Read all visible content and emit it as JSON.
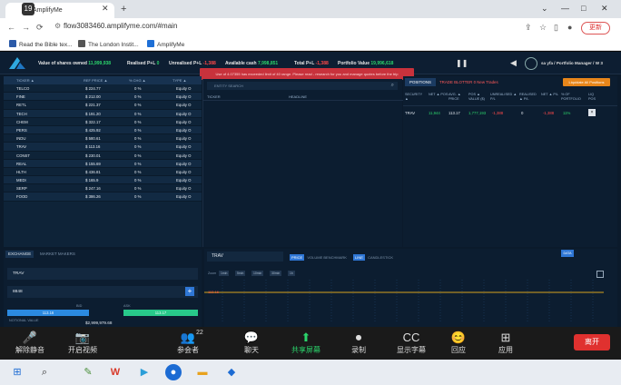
{
  "browser": {
    "tab_title": "AmplifyMe",
    "url": "flow3083460.amplifyme.com/#main",
    "update_label": "更新",
    "bookmarks": [
      "Read the Bible tex...",
      "The London Instit...",
      "AmplifyMe"
    ],
    "zoom_badge": "19"
  },
  "topbar": {
    "shares_label": "Value of shares owned",
    "shares_value": "11,999,938",
    "realised_label": "Realised P+L",
    "realised_value": "0",
    "unrealised_label": "Unrealised P+L",
    "unrealised_value": "-1,388",
    "cash_label": "Available cash",
    "cash_value": "7,998,851",
    "total_label": "Total P+L",
    "total_value": "-1,388",
    "portfolio_label": "Portfolio Value",
    "portfolio_value": "19,996,618",
    "alert": "Use of 4.07355 has exceeded limit of 40 range. Please read - research for you and manage quotes before the trip",
    "user_info": "sa yfa / Portfolio Manager / W 3"
  },
  "ticker": {
    "headers": [
      "TICKER ▲",
      "REF PRICE ▲",
      "% CHG ▲",
      "TYPE ▲"
    ],
    "rows": [
      {
        "ticker": "TELCO",
        "price": "$ 224.77",
        "chg": "0 %",
        "type": "Equity O"
      },
      {
        "ticker": "FINE",
        "price": "$ 212.00",
        "chg": "0 %",
        "type": "Equity O"
      },
      {
        "ticker": "RETL",
        "price": "$ 221.37",
        "chg": "0 %",
        "type": "Equity O"
      },
      {
        "ticker": "TECH",
        "price": "$ 191.20",
        "chg": "0 %",
        "type": "Equity O"
      },
      {
        "ticker": "CHEM",
        "price": "$ 322.17",
        "chg": "0 %",
        "type": "Equity O"
      },
      {
        "ticker": "PERS",
        "price": "$ 425.92",
        "chg": "0 %",
        "type": "Equity O"
      },
      {
        "ticker": "INDU",
        "price": "$ 580.61",
        "chg": "0 %",
        "type": "Equity O"
      },
      {
        "ticker": "TRAV",
        "price": "$ 113.16",
        "chg": "0 %",
        "type": "Equity O"
      },
      {
        "ticker": "CONST",
        "price": "$ 230.01",
        "chg": "0 %",
        "type": "Equity O"
      },
      {
        "ticker": "REAL",
        "price": "$ 155.69",
        "chg": "0 %",
        "type": "Equity O"
      },
      {
        "ticker": "HLTH",
        "price": "$ 436.81",
        "chg": "0 %",
        "type": "Equity O"
      },
      {
        "ticker": "MEDI",
        "price": "$ 165.9",
        "chg": "0 %",
        "type": "Equity O"
      },
      {
        "ticker": "SERP",
        "price": "$ 247.16",
        "chg": "0 %",
        "type": "Equity O"
      },
      {
        "ticker": "FOOD",
        "price": "$ 386.26",
        "chg": "0 %",
        "type": "Equity O"
      }
    ]
  },
  "center": {
    "search_placeholder": "ENTITY SEARCH",
    "col1": "TICKER",
    "col2": "HEADLINE"
  },
  "positions": {
    "tab": "POSITIONS",
    "tab2": "TRADE BLOTTER  0 New Trades",
    "close_all": "Liquidate All Positions",
    "headers": [
      "SECURITY ▲",
      "NET ▲ POS",
      "AVG. ▲ PRICE",
      "POS ▲ VALUE ($)",
      "UNREALISED ▲ P/L",
      "REALISED ▲ P/L",
      "NET ▲ P/L",
      "% OF PORTFOLIO",
      "LIQ POS"
    ],
    "row": {
      "security": "TRAV",
      "net_pos": "11,944",
      "avg_price": "113.17",
      "pos_value": "1,777,193",
      "unrealised": "-1,388",
      "realised": "0",
      "net_pl": "-1,388",
      "pct": "11%",
      "liq": "×"
    }
  },
  "exchange": {
    "tab1": "EXCHANGE",
    "tab2": "MARKET MAKERS",
    "security": "TRAV",
    "qty": "8848",
    "bid_label": "BID",
    "ask_label": "ASK",
    "buy_price": "113.16",
    "sell_price": "113.17",
    "notional_label": "NOTIONAL VALUE",
    "notional_value": "$2,999,979.68"
  },
  "chart": {
    "security": "TRAV",
    "tabs": [
      "PRICE",
      "VOLUME BENCHMARK",
      "LINE",
      "CANDLESTICK"
    ],
    "ranges": [
      "1min",
      "5min",
      "10min",
      "30min",
      "1h"
    ],
    "range_label": "Zoom",
    "blue_btn": "DATA",
    "price_label": "113.16"
  },
  "chart_data": {
    "type": "line",
    "title": "",
    "xlabel": "",
    "ylabel": "",
    "series": [
      {
        "values": [
          113.16,
          113.16,
          113.16,
          113.16,
          113.16
        ]
      }
    ]
  },
  "zoom_toolbar": {
    "items": [
      {
        "label": "解除静音",
        "icon": "🎤"
      },
      {
        "label": "开启视频",
        "icon": "📷"
      },
      {
        "label": "参会者",
        "icon": "👥",
        "count": "22"
      },
      {
        "label": "聊天",
        "icon": "💬"
      },
      {
        "label": "共享屏幕",
        "icon": "⬆"
      },
      {
        "label": "录制",
        "icon": "⏺"
      },
      {
        "label": "显示字幕",
        "icon": "CC"
      },
      {
        "label": "回应",
        "icon": "😊"
      },
      {
        "label": "应用",
        "icon": "⊞"
      }
    ],
    "leave": "离开"
  },
  "colors": {
    "accent": "#2f77d6",
    "loss": "#ff4a4a",
    "gain": "#2bd46b"
  }
}
